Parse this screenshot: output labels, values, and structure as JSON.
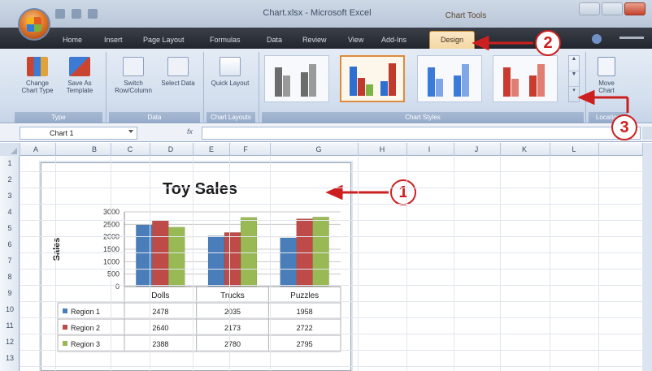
{
  "window": {
    "title": "Chart.xlsx - Microsoft Excel",
    "context_tab_group": "Chart Tools"
  },
  "ribbon_tabs": [
    "Home",
    "Insert",
    "Page Layout",
    "Formulas",
    "Data",
    "Review",
    "View",
    "Add-Ins",
    "Design"
  ],
  "active_tab": "Design",
  "ribbon": {
    "change_chart_type": "Change Chart Type",
    "save_as_template": "Save As Template",
    "switch_row_column": "Switch Row/Column",
    "select_data": "Select Data",
    "quick_layout": "Quick Layout",
    "move_chart": "Move Chart",
    "groups": {
      "type": "Type",
      "data": "Data",
      "chart_layouts": "Chart Layouts",
      "chart_styles": "Chart Styles",
      "location": "Location"
    },
    "chart_styles": [
      {
        "colors": [
          "#6c6c6c",
          "#6c6c6c",
          "#6c6c6c"
        ]
      },
      {
        "colors": [
          "#2f6fd0",
          "#c0392b",
          "#7cb342"
        ]
      },
      {
        "colors": [
          "#3a7ad9",
          "#3a7ad9",
          "#3a7ad9"
        ]
      },
      {
        "colors": [
          "#c93b2e",
          "#c93b2e",
          "#c93b2e"
        ]
      }
    ],
    "selected_style_index": 1
  },
  "formula_bar": {
    "name_box": "Chart 1",
    "fx": "fx",
    "formula": ""
  },
  "sheet": {
    "columns": [
      "A",
      "B",
      "C",
      "D",
      "E",
      "F",
      "G",
      "H",
      "I",
      "J",
      "K",
      "L"
    ],
    "rows": [
      "1",
      "2",
      "3",
      "4",
      "5",
      "6",
      "7",
      "8",
      "9",
      "10",
      "11",
      "12",
      "13"
    ]
  },
  "chart_data": {
    "type": "bar",
    "title": "Toy Sales",
    "xlabel": "",
    "ylabel": "Sales",
    "ylim": [
      0,
      3000
    ],
    "yticks": [
      0,
      500,
      1000,
      1500,
      2000,
      2500,
      3000
    ],
    "categories": [
      "Dolls",
      "Trucks",
      "Puzzles"
    ],
    "series": [
      {
        "name": "Region 1",
        "color": "#4a7ebb",
        "values": [
          2478,
          2035,
          1958
        ]
      },
      {
        "name": "Region 2",
        "color": "#be4b48",
        "values": [
          2640,
          2173,
          2722
        ]
      },
      {
        "name": "Region 3",
        "color": "#98b954",
        "values": [
          2388,
          2780,
          2795
        ]
      }
    ],
    "data_table": true,
    "grid": true
  },
  "callouts": [
    "1",
    "2",
    "3"
  ],
  "colors": {
    "callout_red": "#cc1f1f",
    "design_tab_highlight": "#f4d7a3",
    "ribbon_blue": "#d3dfee"
  }
}
